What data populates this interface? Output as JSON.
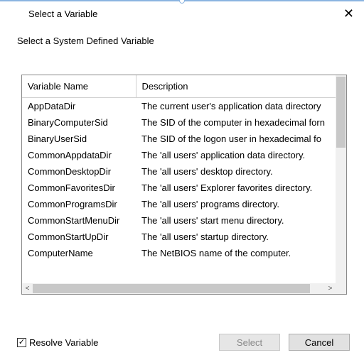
{
  "dialog": {
    "title": "Select a Variable",
    "subtitle": "Select a System Defined Variable"
  },
  "table": {
    "headers": {
      "name": "Variable Name",
      "desc": "Description"
    },
    "rows": [
      {
        "name": "AppDataDir",
        "desc": "The current user's application data directory"
      },
      {
        "name": "BinaryComputerSid",
        "desc": "The SID of the computer in hexadecimal forn"
      },
      {
        "name": "BinaryUserSid",
        "desc": "The SID of the logon user in hexadecimal fo"
      },
      {
        "name": "CommonAppdataDir",
        "desc": "The 'all users' application data directory."
      },
      {
        "name": "CommonDesktopDir",
        "desc": "The 'all users' desktop directory."
      },
      {
        "name": "CommonFavoritesDir",
        "desc": "The 'all users' Explorer favorites directory."
      },
      {
        "name": "CommonProgramsDir",
        "desc": "The 'all users' programs directory."
      },
      {
        "name": "CommonStartMenuDir",
        "desc": "The 'all users' start menu directory."
      },
      {
        "name": "CommonStartUpDir",
        "desc": "The 'all users' startup directory."
      },
      {
        "name": "ComputerName",
        "desc": "The NetBIOS name of the computer."
      }
    ]
  },
  "footer": {
    "resolve_label": "Resolve Variable",
    "resolve_checked": true,
    "select_label": "Select",
    "cancel_label": "Cancel"
  },
  "glyphs": {
    "close": "✕",
    "check": "✓",
    "left": "<",
    "right": ">"
  }
}
